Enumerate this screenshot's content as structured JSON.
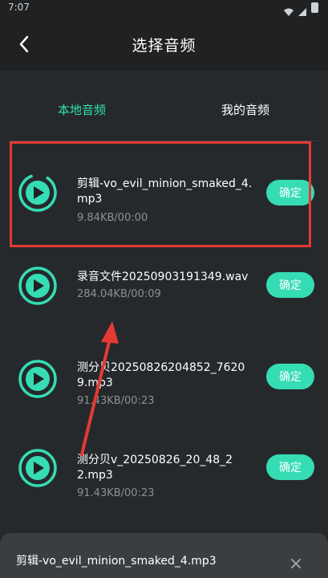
{
  "status_bar": {
    "time": "7:07"
  },
  "header": {
    "title": "选择音频"
  },
  "tabs": [
    {
      "label": "本地音频",
      "active": true
    },
    {
      "label": "我的音频",
      "active": false
    }
  ],
  "items": [
    {
      "name": "剪辑-vo_evil_minion_smaked_4.mp3",
      "meta": "9.84KB/00:00",
      "action": "确定"
    },
    {
      "name": "录音文件20250903191349.wav",
      "meta": "284.04KB/00:09",
      "action": "确定"
    },
    {
      "name": "测分贝20250826204852_76209.mp3",
      "meta": "91.43KB/00:23",
      "action": "确定"
    },
    {
      "name": "测分贝v_20250826_20_48_22.mp3",
      "meta": "91.43KB/00:23",
      "action": "确定"
    }
  ],
  "bottom_bar": {
    "file": "剪辑-vo_evil_minion_smaked_4.mp3"
  },
  "colors": {
    "accent": "#35dcb4",
    "background": "#26292c",
    "highlight": "#e53935"
  }
}
